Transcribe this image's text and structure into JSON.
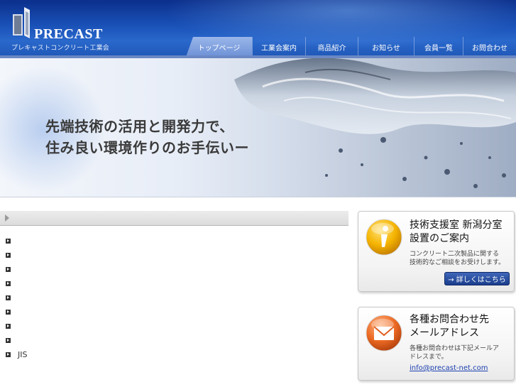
{
  "header": {
    "logo_text": "PRECAST",
    "logo_sub": "プレキャストコンクリート工業会",
    "nav": [
      {
        "label": "トップページ",
        "active": true
      },
      {
        "label": "工業会案内",
        "active": false
      },
      {
        "label": "商品紹介",
        "active": false
      },
      {
        "label": "お知らせ",
        "active": false
      },
      {
        "label": "会員一覧",
        "active": false
      },
      {
        "label": "お問合わせ",
        "active": false
      }
    ]
  },
  "hero": {
    "line1": "先端技術の活用と開発力で、",
    "line2": "住み良い環境作りのお手伝いー"
  },
  "main": {
    "list_items": [
      "",
      "",
      "",
      "",
      "",
      "",
      "",
      "",
      "JIS"
    ]
  },
  "sidebar": {
    "support": {
      "title_line1": "技術支援室 新潟分室",
      "title_line2": "設置のご案内",
      "desc_line1": "コンクリート二次製品に関する",
      "desc_line2": "技術的なご相談をお受けします。",
      "button": "→ 詳しくはこちら",
      "icon": "info-icon"
    },
    "contact": {
      "title_line1": "各種お問合わせ先",
      "title_line2": "メールアドレス",
      "desc_line1": "各種お問合わせは下記メールア",
      "desc_line2": "ドレスまで。",
      "email": "info@precast-net.com",
      "icon": "envelope-icon"
    }
  },
  "colors": {
    "header_blue": "#1a52b8",
    "nav_active": "#8aa9e3",
    "button_blue": "#1a3d8c",
    "info_orange": "#f0a500",
    "mail_orange": "#e8641e"
  }
}
